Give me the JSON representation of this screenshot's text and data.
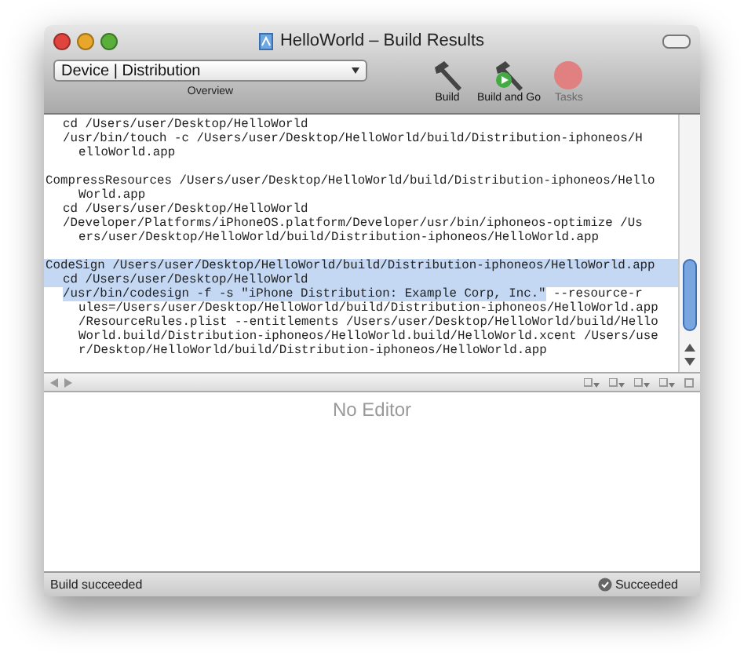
{
  "window": {
    "title": "HelloWorld – Build Results"
  },
  "toolbar": {
    "configuration": "Device | Distribution",
    "overview_label": "Overview",
    "buttons": [
      {
        "label": "Build",
        "kind": "build",
        "disabled": false
      },
      {
        "label": "Build and Go",
        "kind": "build_and_go",
        "disabled": false
      },
      {
        "label": "Tasks",
        "kind": "tasks",
        "disabled": true
      }
    ]
  },
  "log": {
    "lines": [
      {
        "kind": "step",
        "selected": false,
        "text": "cd /Users/user/Desktop/HelloWorld"
      },
      {
        "kind": "step",
        "selected": false,
        "text": "/usr/bin/touch -c /Users/user/Desktop/HelloWorld/build/Distribution-iphoneos/H"
      },
      {
        "kind": "wrap",
        "selected": false,
        "text": "elloWorld.app"
      },
      {
        "kind": "blank"
      },
      {
        "kind": "command",
        "selected": false,
        "text": "CompressResources /Users/user/Desktop/HelloWorld/build/Distribution-iphoneos/Hello"
      },
      {
        "kind": "wrap",
        "selected": false,
        "text": "World.app"
      },
      {
        "kind": "step",
        "selected": false,
        "text": "cd /Users/user/Desktop/HelloWorld"
      },
      {
        "kind": "step",
        "selected": false,
        "text": "/Developer/Platforms/iPhoneOS.platform/Developer/usr/bin/iphoneos-optimize /Us"
      },
      {
        "kind": "wrap",
        "selected": false,
        "text": "ers/user/Desktop/HelloWorld/build/Distribution-iphoneos/HelloWorld.app"
      },
      {
        "kind": "blank"
      },
      {
        "kind": "command",
        "selected": true,
        "text": "CodeSign /Users/user/Desktop/HelloWorld/build/Distribution-iphoneos/HelloWorld.app"
      },
      {
        "kind": "step",
        "selected": true,
        "text": "cd /Users/user/Desktop/HelloWorld"
      },
      {
        "kind": "step",
        "segments": [
          {
            "text": "/usr/bin/codesign -f -s \"iPhone Distribution: Example Corp, Inc.\"",
            "selected": true
          },
          {
            "text": " --resource-r",
            "selected": false
          }
        ]
      },
      {
        "kind": "wrap",
        "selected": false,
        "text": "ules=/Users/user/Desktop/HelloWorld/build/Distribution-iphoneos/HelloWorld.app"
      },
      {
        "kind": "wrap",
        "selected": false,
        "text": "/ResourceRules.plist --entitlements /Users/user/Desktop/HelloWorld/build/Hello"
      },
      {
        "kind": "wrap",
        "selected": false,
        "text": "World.build/Distribution-iphoneos/HelloWorld.build/HelloWorld.xcent /Users/use"
      },
      {
        "kind": "wrap",
        "selected": false,
        "text": "r/Desktop/HelloWorld/build/Distribution-iphoneos/HelloWorld.app"
      }
    ]
  },
  "editor": {
    "placeholder_text": "No Editor"
  },
  "status_bar": {
    "message": "Build succeeded",
    "result": "Succeeded"
  }
}
